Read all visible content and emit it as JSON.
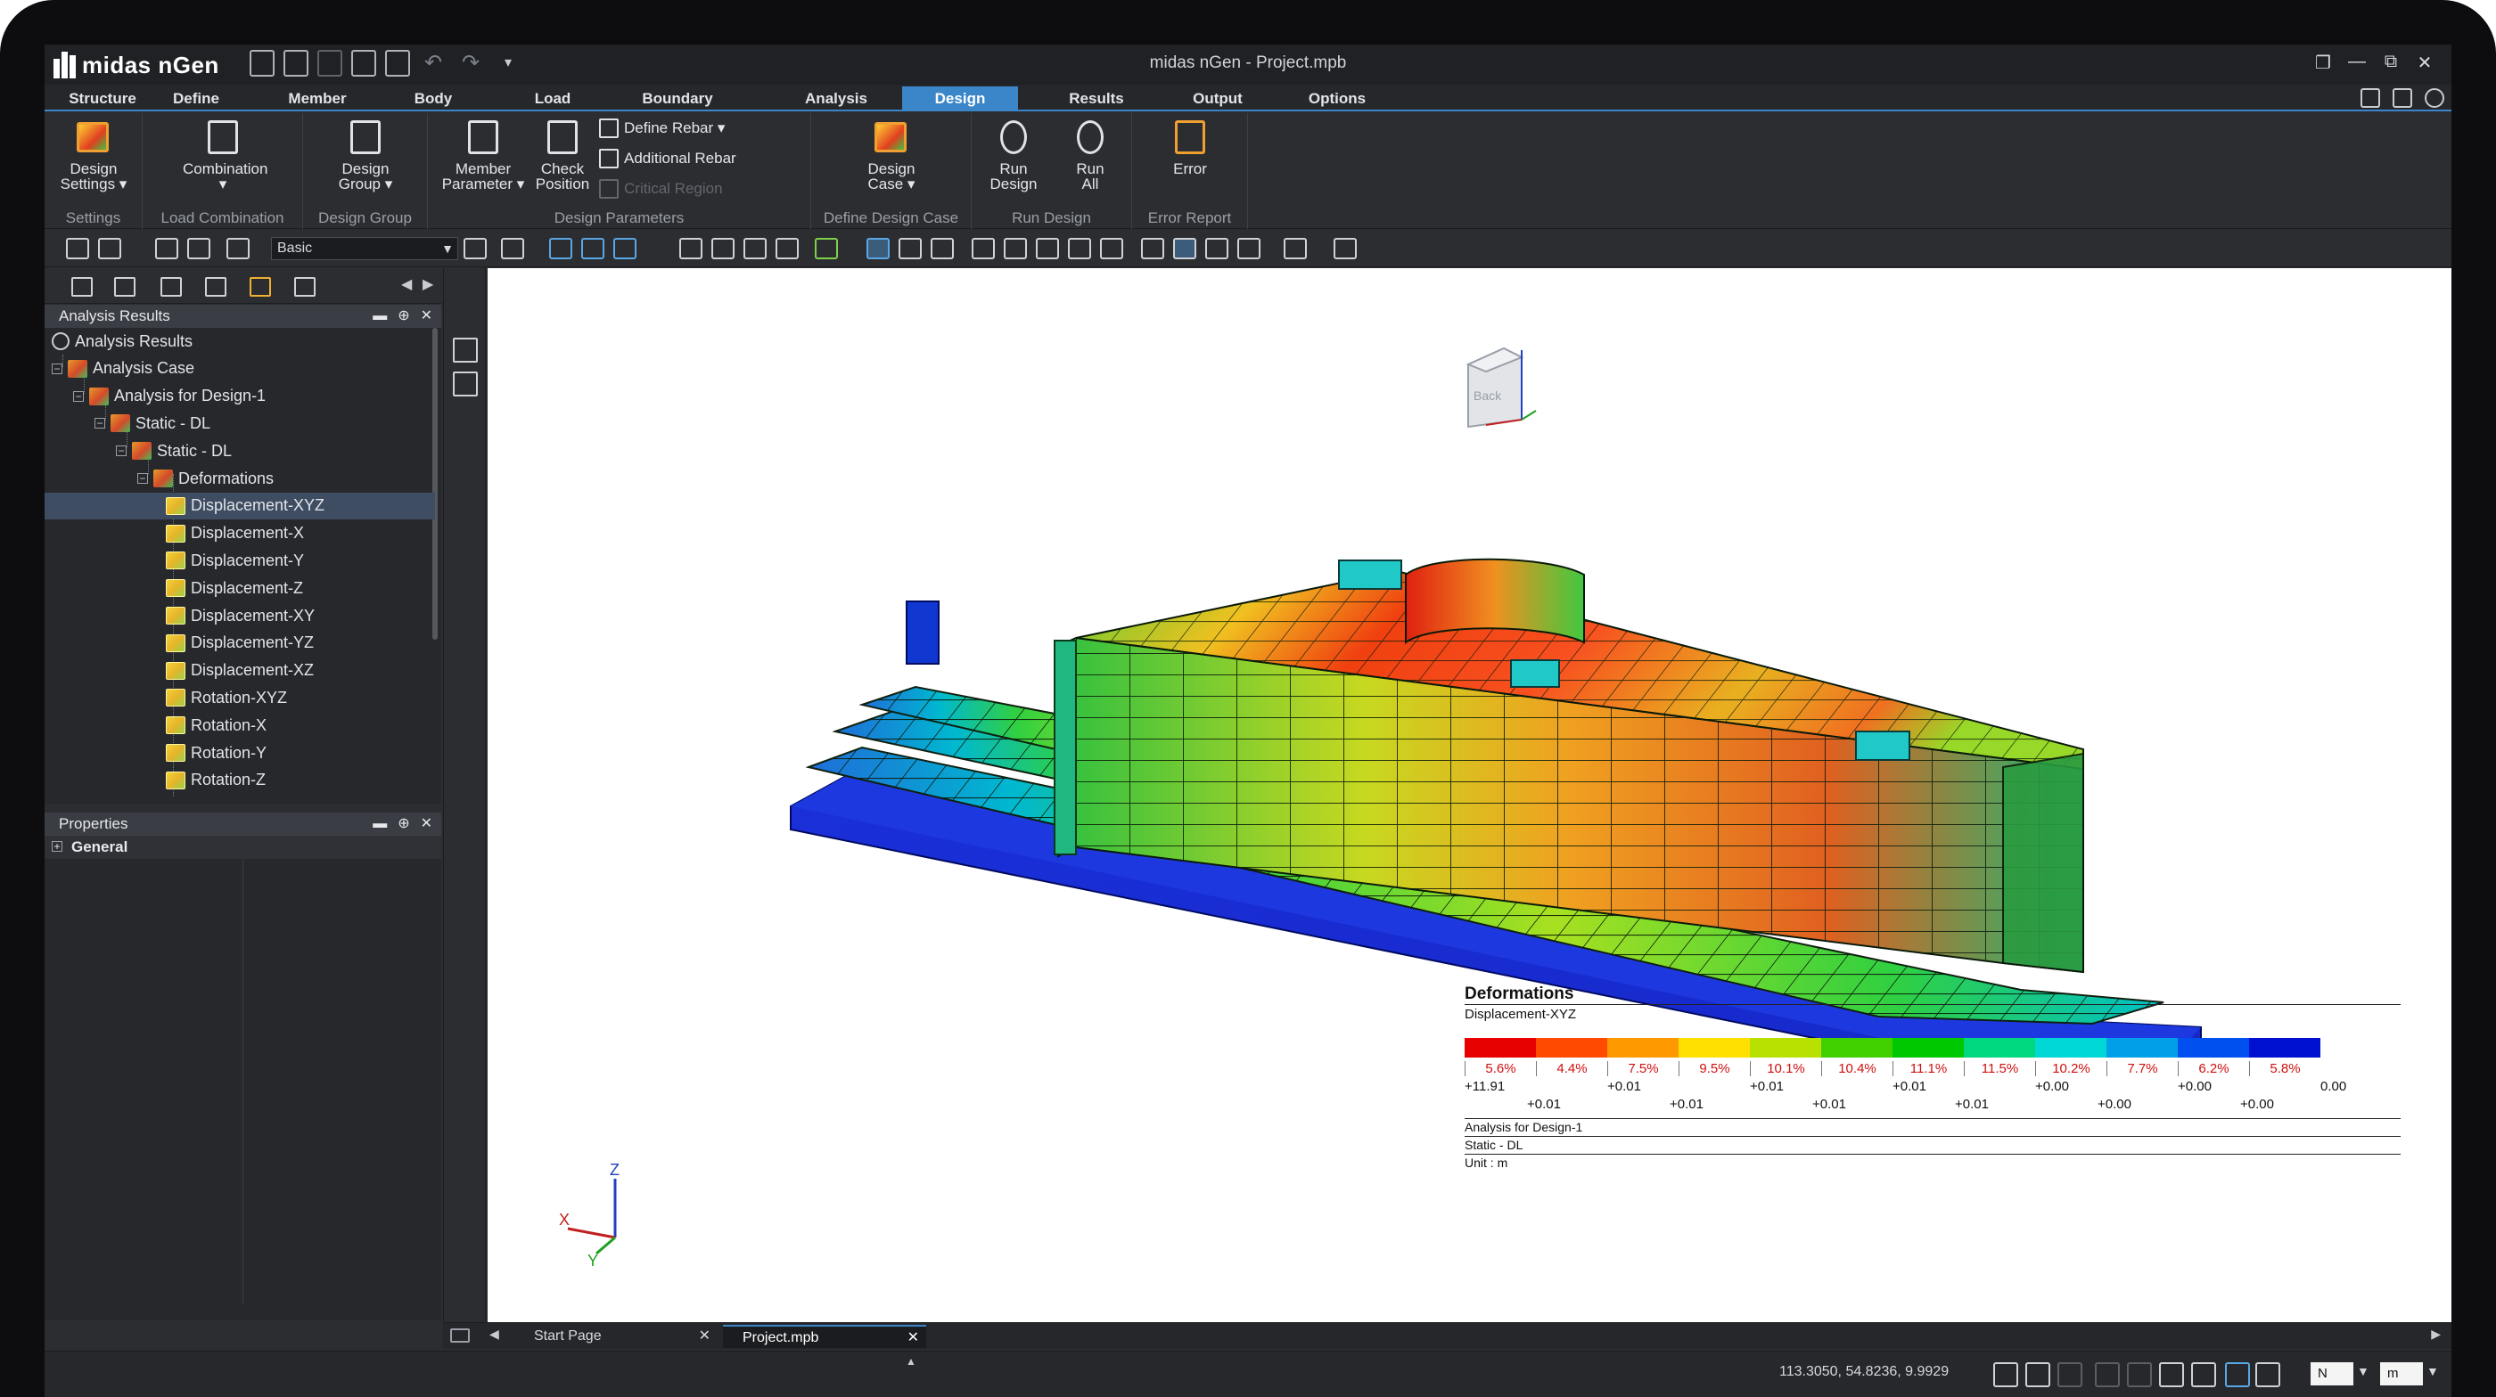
{
  "app": {
    "logo_text": "midas nGen",
    "window_title": "midas nGen - Project.mpb"
  },
  "window_controls": [
    "❐",
    "—",
    "⧉",
    "✕"
  ],
  "ribbon_tabs": [
    {
      "label": "Structure",
      "active": false
    },
    {
      "label": "Define",
      "active": false
    },
    {
      "label": "Member",
      "active": false
    },
    {
      "label": "Body",
      "active": false
    },
    {
      "label": "Load",
      "active": false
    },
    {
      "label": "Boundary",
      "active": false
    },
    {
      "label": "Analysis",
      "active": false
    },
    {
      "label": "Design",
      "active": true
    },
    {
      "label": "Results",
      "active": false
    },
    {
      "label": "Output",
      "active": false
    },
    {
      "label": "Options",
      "active": false
    }
  ],
  "ribbon": {
    "groups": {
      "settings": "Settings",
      "load_combination": "Load Combination",
      "design_group": "Design Group",
      "design_parameters": "Design Parameters",
      "define_design_case": "Define Design Case",
      "run_design": "Run Design",
      "error_report": "Error Report"
    },
    "buttons": {
      "design_settings_1": "Design",
      "design_settings_2": "Settings ▾",
      "combination": "Combination",
      "combination_arrow": "▾",
      "design_group_1": "Design",
      "design_group_2": "Group ▾",
      "member_parameter_1": "Member",
      "member_parameter_2": "Parameter ▾",
      "check_position_1": "Check",
      "check_position_2": "Position",
      "define_rebar": "Define Rebar ▾",
      "additional_rebar": "Additional Rebar",
      "critical_region": "Critical Region",
      "design_case_1": "Design",
      "design_case_2": "Case ▾",
      "run_design_1": "Run",
      "run_design_2": "Design",
      "run_all_1": "Run",
      "run_all_2": "All",
      "error": "Error"
    }
  },
  "toolbar": {
    "view_mode": "Basic"
  },
  "analysis_panel": {
    "title": "Analysis Results",
    "tree": [
      {
        "label": "Analysis Results",
        "icon": "circle"
      },
      {
        "label": "Analysis Case",
        "icon": "folder"
      },
      {
        "label": "Analysis for Design-1",
        "icon": "folder"
      },
      {
        "label": "Static - DL",
        "icon": "folder"
      },
      {
        "label": "Static - DL",
        "icon": "folder"
      },
      {
        "label": "Deformations",
        "icon": "folder"
      },
      {
        "label": "Displacement-XYZ",
        "icon": "disp",
        "selected": true
      },
      {
        "label": "Displacement-X",
        "icon": "disp"
      },
      {
        "label": "Displacement-Y",
        "icon": "disp"
      },
      {
        "label": "Displacement-Z",
        "icon": "disp"
      },
      {
        "label": "Displacement-XY",
        "icon": "disp"
      },
      {
        "label": "Displacement-YZ",
        "icon": "disp"
      },
      {
        "label": "Displacement-XZ",
        "icon": "disp"
      },
      {
        "label": "Rotation-XYZ",
        "icon": "disp"
      },
      {
        "label": "Rotation-X",
        "icon": "disp"
      },
      {
        "label": "Rotation-Y",
        "icon": "disp"
      },
      {
        "label": "Rotation-Z",
        "icon": "disp"
      }
    ]
  },
  "properties_panel": {
    "title": "Properties",
    "section": "General"
  },
  "legend": {
    "title": "Deformations",
    "subtitle": "Displacement-XYZ",
    "colors": [
      "#e60000",
      "#ff4a00",
      "#ff9900",
      "#ffe000",
      "#b8e000",
      "#40d000",
      "#00c800",
      "#00d880",
      "#00d8d8",
      "#00a0e8",
      "#0050f0",
      "#0010d0"
    ],
    "percentages": [
      "5.6%",
      "4.4%",
      "7.5%",
      "9.5%",
      "10.1%",
      "10.4%",
      "11.1%",
      "11.5%",
      "10.2%",
      "7.7%",
      "6.2%",
      "5.8%"
    ],
    "values_row1": [
      "+11.91",
      "+0.01",
      "+0.01",
      "+0.01",
      "+0.00",
      "+0.00",
      "0.00"
    ],
    "values_row2": [
      "+0.01",
      "+0.01",
      "+0.01",
      "+0.01",
      "+0.00",
      "+0.00"
    ],
    "footer": [
      "Analysis for Design-1",
      "Static - DL",
      "Unit : m"
    ]
  },
  "axes": {
    "z": "Z",
    "x": "X",
    "y": "Y"
  },
  "view_cube": {
    "face": "Back"
  },
  "doc_tabs": [
    {
      "label": "Start Page",
      "active": false
    },
    {
      "label": "Project.mpb",
      "active": true
    }
  ],
  "status": {
    "coordinates": "113.3050, 54.8236, 9.9929",
    "force_unit": "N",
    "length_unit": "m"
  }
}
